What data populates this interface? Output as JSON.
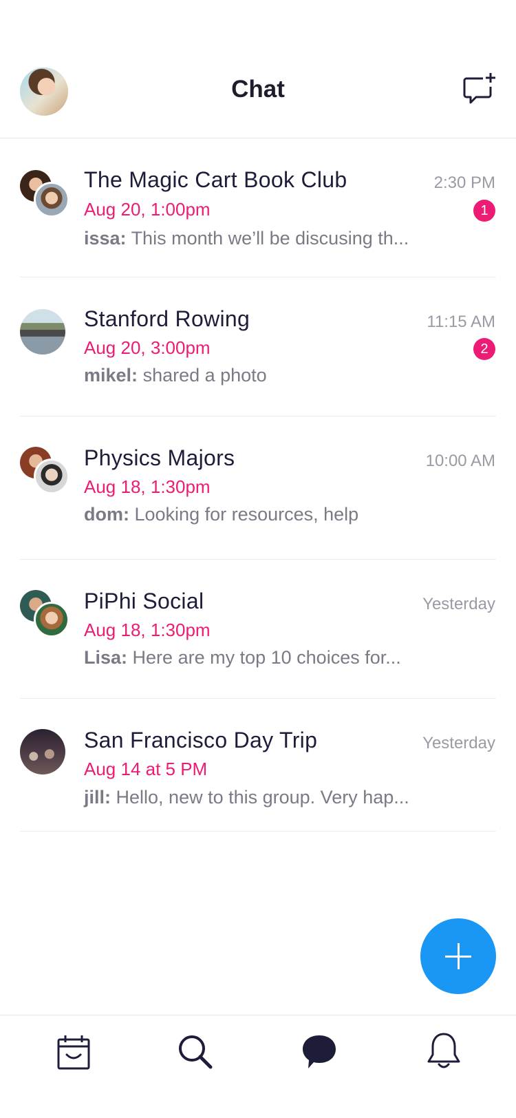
{
  "header": {
    "title": "Chat"
  },
  "chats": [
    {
      "name": "The Magic Cart Book Club",
      "date": "Aug 20, 1:00pm",
      "sender": "issa:",
      "message": "This month we’ll be discusing th...",
      "time": "2:30 PM",
      "unread": "1"
    },
    {
      "name": "Stanford Rowing",
      "date": "Aug 20, 3:00pm",
      "sender": "mikel:",
      "message": "shared a photo",
      "time": "11:15 AM",
      "unread": "2"
    },
    {
      "name": "Physics Majors",
      "date": "Aug 18, 1:30pm",
      "sender": "dom:",
      "message": "Looking for resources, help",
      "time": "10:00 AM"
    },
    {
      "name": "PiPhi Social",
      "date": "Aug 18, 1:30pm",
      "sender": "Lisa:",
      "message": "Here are my top 10 choices for...",
      "time": "Yesterday"
    },
    {
      "name": "San Francisco Day Trip",
      "date": "Aug 14 at 5 PM",
      "sender": "jill:",
      "message": "Hello, new to this group. Very hap...",
      "time": "Yesterday"
    }
  ],
  "icons": {
    "new_chat": "new-chat-icon",
    "fab": "plus-icon",
    "tabs": [
      "calendar-icon",
      "search-icon",
      "chat-bubble-icon",
      "bell-icon"
    ]
  },
  "colors": {
    "accent_pink": "#ec1c74",
    "fab_blue": "#1a96f5",
    "title_dark": "#1d1d3a"
  }
}
